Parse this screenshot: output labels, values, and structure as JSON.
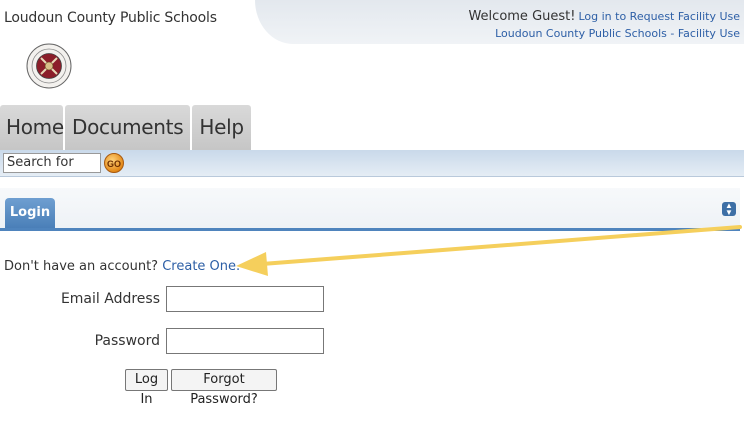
{
  "header": {
    "org_name": "Loudoun County Public Schools",
    "welcome": "Welcome Guest!",
    "login_link": "Log in to Request Facility Use",
    "org_link": "Loudoun County Public Schools - Facility Use"
  },
  "nav": {
    "tabs": [
      {
        "label": "Home"
      },
      {
        "label": "Documents"
      },
      {
        "label": "Help"
      }
    ]
  },
  "search": {
    "placeholder": "Search for",
    "go_label": "GO"
  },
  "panel": {
    "tab_label": "Login",
    "toggle_icon": "collapse-toggle-icon"
  },
  "login": {
    "signup_prompt": "Don't have an account?",
    "signup_link": "Create One.",
    "email_label": "Email Address",
    "email_value": "",
    "password_label": "Password",
    "password_value": "",
    "login_button": "Log In",
    "forgot_button": "Forgot Password?"
  },
  "colors": {
    "link": "#2d5fa6",
    "panel_accent": "#4f84bd",
    "annotation_arrow": "#f7d46a",
    "nav_tab": "#cfcfcf"
  }
}
